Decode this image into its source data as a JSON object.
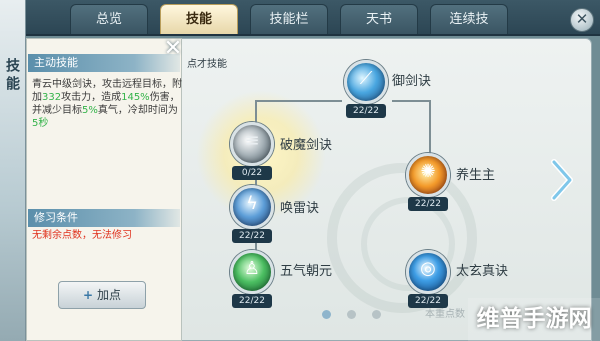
{
  "side_title": "技能",
  "tabs": [
    {
      "label": "总览",
      "active": false
    },
    {
      "label": "技能",
      "active": true
    },
    {
      "label": "技能栏",
      "active": false
    },
    {
      "label": "天书",
      "active": false
    },
    {
      "label": "连续技",
      "active": false
    }
  ],
  "close_label": "✕",
  "info_panel": {
    "close_label": "✕",
    "active_skill_header": "主动技能",
    "description": {
      "t1": "青云中级剑诀，攻击远程目标，附加",
      "v1": "332",
      "t2": "攻击力，造成",
      "v2": "145%",
      "t3": "伤害，并减少目标",
      "v3": "5%",
      "t4": "真气，冷却时间为",
      "v4": "5秒"
    },
    "requirement_header": "修习条件",
    "requirement_text": "无剩余点数，无法修习",
    "add_point_button": "加点"
  },
  "corner_hint": "点才技能",
  "skills": [
    {
      "name": "御剑诀",
      "level": "22/22",
      "icon": "sword-light-icon"
    },
    {
      "name": "破魔剑诀",
      "level": "0/22",
      "icon": "blade-icon"
    },
    {
      "name": "养生主",
      "level": "22/22",
      "icon": "fire-icon"
    },
    {
      "name": "唤雷诀",
      "level": "22/22",
      "icon": "thunder-icon"
    },
    {
      "name": "五气朝元",
      "level": "22/22",
      "icon": "spirit-icon"
    },
    {
      "name": "太玄真诀",
      "level": "22/22",
      "icon": "vortex-icon"
    }
  ],
  "bottom_hint": "本重点数",
  "watermark": "维普手游网",
  "colors": {
    "tab_active_bg": "#e7d7a9",
    "highlight_green": "#34b34a",
    "warning_red": "#e0321e",
    "badge_bg": "#1e3848"
  }
}
